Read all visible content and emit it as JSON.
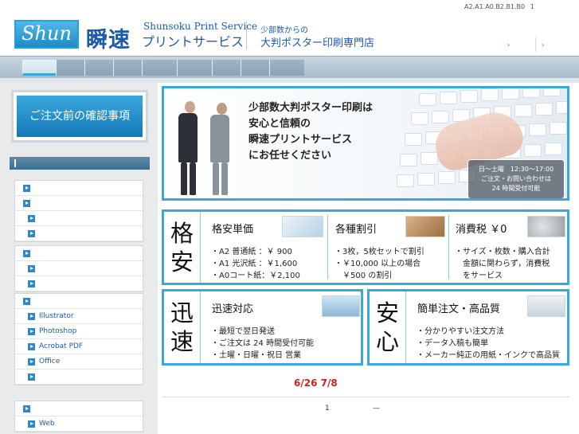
{
  "header": {
    "top_links": [
      "A2.A1.A0.B2.B1.B0",
      "1"
    ],
    "logo_text": "Shun",
    "logo_kanji": "瞬速",
    "logo_en": "Shunsoku Print Service",
    "logo_jp": "プリントサービス",
    "tagline_small": "少部数からの",
    "tagline_main": "大判ポスター印刷専門店",
    "links": [
      "›",
      "›"
    ]
  },
  "sidebar": {
    "notice": "ご注文前の確認事項",
    "menu_group1": [
      "",
      "",
      "",
      ""
    ],
    "menu_group2": [
      "",
      "",
      ""
    ],
    "menu_group3": [
      "",
      "Illustrator",
      "Photoshop",
      "Acrobat PDF",
      "Office",
      ""
    ],
    "menu_group4": [
      "",
      "Web"
    ]
  },
  "banner": {
    "lines": [
      "少部数大判ポスター印刷は",
      "安心と信頼の",
      "瞬速プリントサービス",
      "にお任せください"
    ],
    "hours": [
      "日～土曜　12:30～17:00",
      "ご注文・お問い合わせは",
      "24 時間受付可能"
    ]
  },
  "features": {
    "k1": [
      "格",
      "安"
    ],
    "k2": [
      "迅",
      "速"
    ],
    "k3": [
      "安",
      "心"
    ],
    "price": {
      "title": "格安単価",
      "lines": [
        "・A2 普通紙 ：￥ 900",
        "・A1 光沢紙 ：￥1,600",
        "・A0コート紙：￥2,100"
      ]
    },
    "discount": {
      "title": "各種割引",
      "lines": [
        "・3枚，5枚セットで割引",
        "・￥10,000 以上の場合",
        "　￥500 の割引"
      ]
    },
    "tax": {
      "title": "消費税 ￥0",
      "lines": [
        "・サイズ・枚数・購入合計",
        "　金額に関わらず，消費税",
        "　をサービス"
      ]
    },
    "speed": {
      "title": "迅速対応",
      "lines": [
        "・最短で翌日発送",
        "・ご注文は 24 時間受付可能",
        "・土曜・日曜・祝日 営業"
      ]
    },
    "easy": {
      "title": "簡単注文・高品質",
      "lines": [
        "・分かりやすい注文方法",
        "・データ入稿も簡単",
        "・メーカー純正の用紙・インクで高品質"
      ]
    }
  },
  "dates": "6/26  7/8",
  "footer": [
    "1",
    "—"
  ],
  "colors": {
    "accent": "#39a9dc",
    "brand": "#1e5aa8",
    "date_red": "#d21e1e"
  }
}
